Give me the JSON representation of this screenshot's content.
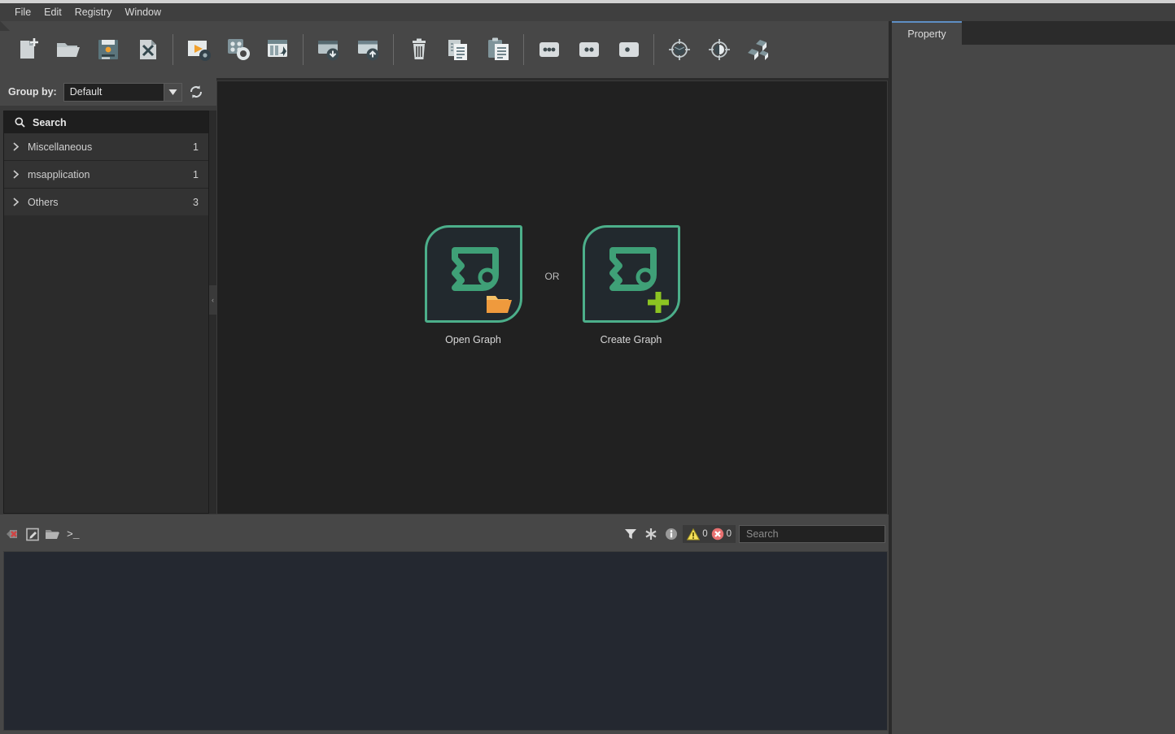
{
  "app": {
    "menubar": [
      {
        "label": "File",
        "name": "menu-file"
      },
      {
        "label": "Edit",
        "name": "menu-edit"
      },
      {
        "label": "Registry",
        "name": "menu-registry"
      },
      {
        "label": "Window",
        "name": "menu-window"
      }
    ]
  },
  "toolbar": {
    "buttons": [
      {
        "icon": "new-file-icon",
        "label": "New"
      },
      {
        "icon": "open-folder-icon",
        "label": "Open"
      },
      {
        "icon": "save-icon",
        "label": "Save"
      },
      {
        "icon": "close-file-icon",
        "label": "Close"
      },
      {
        "icon": "run-settings-icon",
        "label": "Run"
      },
      {
        "icon": "configure-modules-icon",
        "label": "Configure"
      },
      {
        "icon": "execute-window-icon",
        "label": "Execute"
      },
      {
        "icon": "import-window-icon",
        "label": "Import"
      },
      {
        "icon": "export-window-icon",
        "label": "Export"
      },
      {
        "icon": "trash-icon",
        "label": "Delete"
      },
      {
        "icon": "copy-icon",
        "label": "Copy"
      },
      {
        "icon": "paste-icon",
        "label": "Paste"
      },
      {
        "icon": "three-dots-icon",
        "label": "Three Dots"
      },
      {
        "icon": "two-dots-icon",
        "label": "Two Dots"
      },
      {
        "icon": "one-dot-icon",
        "label": "One Dot"
      },
      {
        "icon": "target-cube-icon",
        "label": "Target Cube"
      },
      {
        "icon": "target-sphere-icon",
        "label": "Target Sphere"
      },
      {
        "icon": "blocks-icon",
        "label": "Blocks"
      }
    ]
  },
  "groupbar": {
    "label": "Group by:",
    "selected": "Default",
    "options": [
      "Default"
    ],
    "refresh_icon": "refresh-icon",
    "dropdown_icon": "chevron-down-icon"
  },
  "tree": {
    "search": {
      "label": "Search",
      "icon": "search-icon"
    },
    "rows": [
      {
        "label": "Miscellaneous",
        "count": "1",
        "chevron": "chevron-right-icon"
      },
      {
        "label": "msapplication",
        "count": "1",
        "chevron": "chevron-right-icon"
      },
      {
        "label": "Others",
        "count": "3",
        "chevron": "chevron-right-icon"
      }
    ]
  },
  "splitter": {
    "glyph": "‹"
  },
  "canvas": {
    "or_text": "OR",
    "choices": [
      {
        "label": "Open Graph",
        "icon": "graph-open-icon",
        "badge": "folder-badge-icon",
        "name": "open-graph-button"
      },
      {
        "label": "Create Graph",
        "icon": "graph-create-icon",
        "badge": "plus-badge-icon",
        "name": "create-graph-button"
      }
    ]
  },
  "property_panel": {
    "tabs": [
      {
        "label": "Property",
        "name": "tab-property"
      }
    ]
  },
  "console": {
    "buttons": [
      {
        "icon": "clear-console-icon",
        "label": "Clear"
      },
      {
        "icon": "edit-script-icon",
        "label": "Edit"
      },
      {
        "icon": "open-script-icon",
        "label": "Open"
      }
    ],
    "prompt": ">_",
    "filter_icon": "filter-icon",
    "asterisk_icon": "asterisk-icon",
    "info_icon": "info-icon",
    "warning": {
      "icon": "warning-icon",
      "count": "0"
    },
    "error": {
      "icon": "error-icon",
      "count": "0"
    },
    "search": {
      "placeholder": "Search",
      "value": ""
    }
  },
  "colors": {
    "accent_green": "#4caf8a",
    "accent_orange": "#f0a02e",
    "accent_lime": "#8cc422",
    "warning_yellow": "#f5e05a",
    "error_red": "#e87070",
    "tab_active": "#5e8fc4",
    "toolbar_bg": "#474747",
    "canvas_bg": "#212121"
  }
}
